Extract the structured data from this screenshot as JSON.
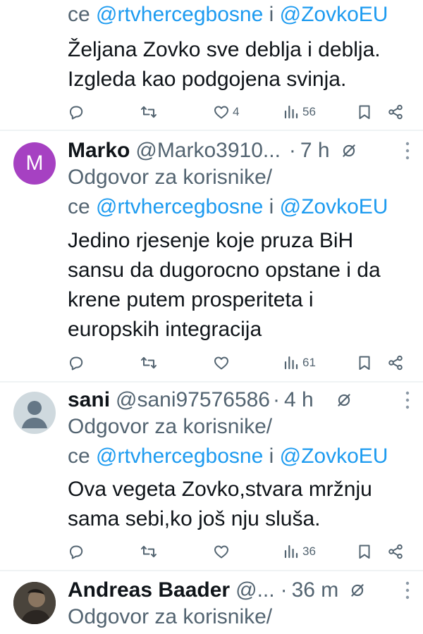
{
  "colors": {
    "accent": "#1d9bf0",
    "muted": "#536471",
    "text": "#0f1419",
    "divider": "#eff3f4",
    "avatar_marko": "#a641c2",
    "avatar_default": "#cfd9de"
  },
  "prev_tweet": {
    "reply_to_tail": "ce",
    "mention_1": "@rtvhercegbosne",
    "and": "i",
    "mention_2": "@ZovkoEU",
    "body": [
      "Željana Zovko sve deblja i deblja.",
      "Izgleda kao podgojena svinja."
    ],
    "likes": "4",
    "views": "56"
  },
  "tweets": [
    {
      "avatar_letter": "M",
      "name": "Marko",
      "handle": "@Marko3910...",
      "time": "7 h",
      "reply_label": "Odgovor za korisnike/",
      "reply_to_tail": "ce",
      "mention_1": "@rtvhercegbosne",
      "and": "i",
      "mention_2": "@ZovkoEU",
      "body": [
        "Jedino rjesenje koje pruza BiH",
        "sansu da dugorocno opstane i da",
        "krene putem prosperiteta i",
        "europskih integracija"
      ],
      "views": "61"
    },
    {
      "avatar_icon": "default-user-icon",
      "name": "sani",
      "handle": "@sani97576586",
      "time": "4 h",
      "reply_label": "Odgovor za korisnike/",
      "reply_to_tail": "ce",
      "mention_1": "@rtvhercegbosne",
      "and": "i",
      "mention_2": "@ZovkoEU",
      "body": [
        "Ova vegeta Zovko,stvara mržnju",
        "sama sebi,ko još nju sluša."
      ],
      "views": "36"
    },
    {
      "avatar_icon": "photo-avatar",
      "name": "Andreas Baader",
      "handle": "@...",
      "time": "36 m",
      "reply_label": "Odgovor za korisnike/"
    }
  ],
  "separator": "·",
  "icons": [
    "reply-icon",
    "retweet-icon",
    "like-icon",
    "views-icon",
    "bookmark-icon",
    "share-icon",
    "more-icon",
    "hide-icon"
  ]
}
